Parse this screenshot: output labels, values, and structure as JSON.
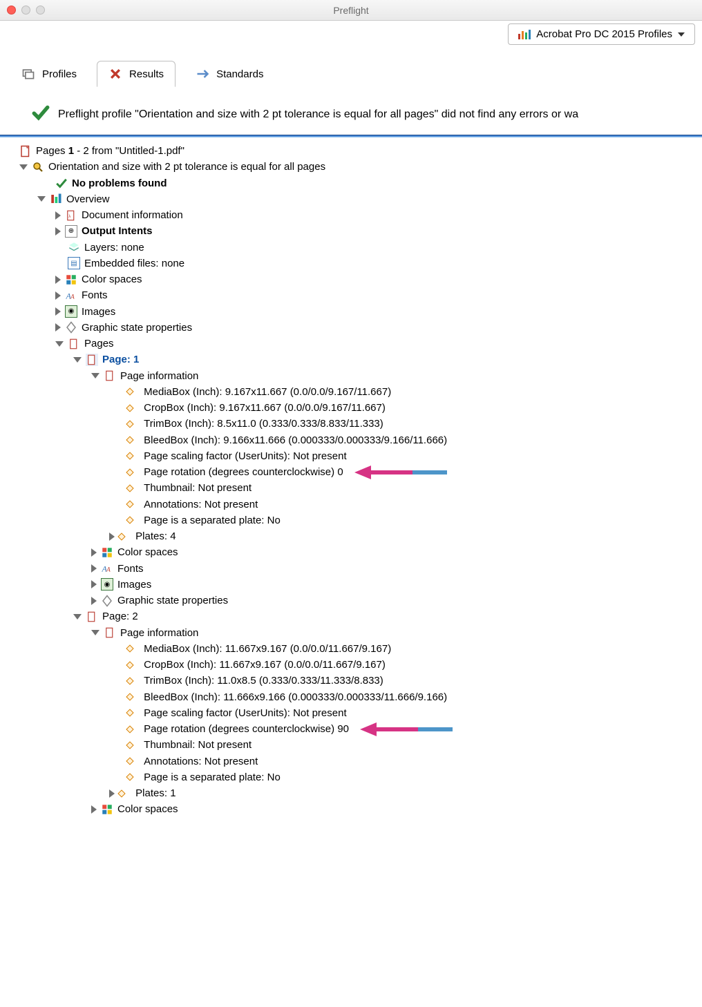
{
  "window": {
    "title": "Preflight"
  },
  "profileSelector": {
    "label": "Acrobat Pro DC 2015 Profiles"
  },
  "tabs": {
    "profiles": "Profiles",
    "results": "Results",
    "standards": "Standards"
  },
  "statusMessage": "Preflight profile \"Orientation and size with 2 pt tolerance is equal for all pages\" did not find any errors or wa",
  "tree": {
    "header_prefix": "Pages ",
    "header_pages": "1",
    "header_suffix": " - 2 from \"Untitled-1.pdf\"",
    "profileName": "Orientation and size with 2 pt tolerance is equal for all pages",
    "noProblems": "No problems found",
    "overview": "Overview",
    "docInfo": "Document information",
    "outputIntents": "Output Intents",
    "layers": "Layers: none",
    "embedded": "Embedded files: none",
    "colorSpaces": "Color spaces",
    "fonts": "Fonts",
    "images": "Images",
    "graphicState": "Graphic state properties",
    "pagesLabel": "Pages",
    "page1": {
      "title": "Page: 1",
      "pageInfo": "Page information",
      "mediabox": "MediaBox (Inch): 9.167x11.667 (0.0/0.0/9.167/11.667)",
      "cropbox": "CropBox (Inch): 9.167x11.667 (0.0/0.0/9.167/11.667)",
      "trimbox": "TrimBox (Inch): 8.5x11.0 (0.333/0.333/8.833/11.333)",
      "bleedbox": "BleedBox (Inch): 9.166x11.666 (0.000333/0.000333/9.166/11.666)",
      "scaling": "Page scaling factor (UserUnits): Not present",
      "rotation": "Page rotation (degrees counterclockwise) 0",
      "thumb": "Thumbnail: Not present",
      "annots": "Annotations: Not present",
      "sep": "Page is a separated plate: No",
      "plates": "Plates: 4",
      "colorSpaces": "Color spaces",
      "fonts": "Fonts",
      "images": "Images",
      "graphicState": "Graphic state properties"
    },
    "page2": {
      "title": "Page: 2",
      "pageInfo": "Page information",
      "mediabox": "MediaBox (Inch): 11.667x9.167 (0.0/0.0/11.667/9.167)",
      "cropbox": "CropBox (Inch): 11.667x9.167 (0.0/0.0/11.667/9.167)",
      "trimbox": "TrimBox (Inch): 11.0x8.5 (0.333/0.333/11.333/8.833)",
      "bleedbox": "BleedBox (Inch): 11.666x9.166 (0.000333/0.000333/11.666/9.166)",
      "scaling": "Page scaling factor (UserUnits): Not present",
      "rotation": "Page rotation (degrees counterclockwise) 90",
      "thumb": "Thumbnail: Not present",
      "annots": "Annotations: Not present",
      "sep": "Page is a separated plate: No",
      "plates": "Plates: 1",
      "colorSpaces": "Color spaces"
    }
  }
}
